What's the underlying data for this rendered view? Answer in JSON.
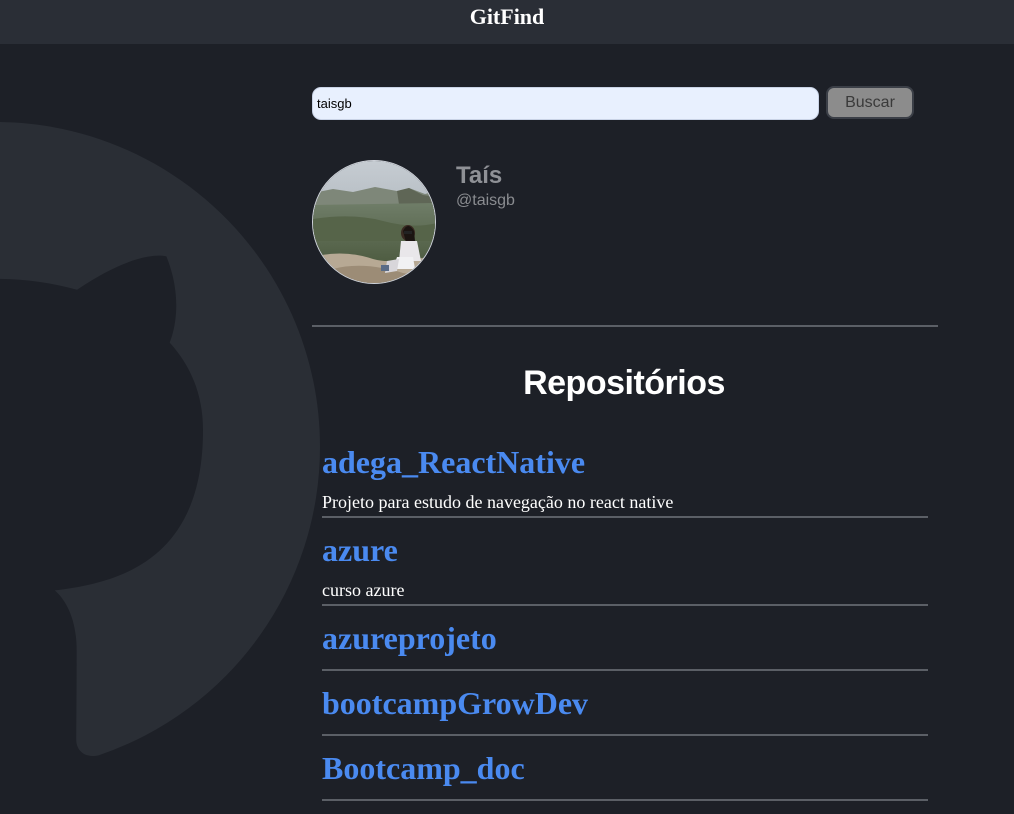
{
  "header": {
    "title": "GitFind"
  },
  "search": {
    "value": "taisgb",
    "button_label": "Buscar"
  },
  "profile": {
    "name": "Taís",
    "login": "@taisgb"
  },
  "repos": {
    "title": "Repositórios",
    "items": [
      {
        "name": "adega_ReactNative",
        "description": "Projeto para estudo de navegação no react native"
      },
      {
        "name": "azure",
        "description": "curso azure"
      },
      {
        "name": "azureprojeto",
        "description": ""
      },
      {
        "name": "bootcampGrowDev",
        "description": ""
      },
      {
        "name": "Bootcamp_doc",
        "description": ""
      }
    ]
  },
  "colors": {
    "background": "#1d2027",
    "header": "#2a2e36",
    "link": "#4a8af0",
    "divider": "#5b5f66"
  }
}
